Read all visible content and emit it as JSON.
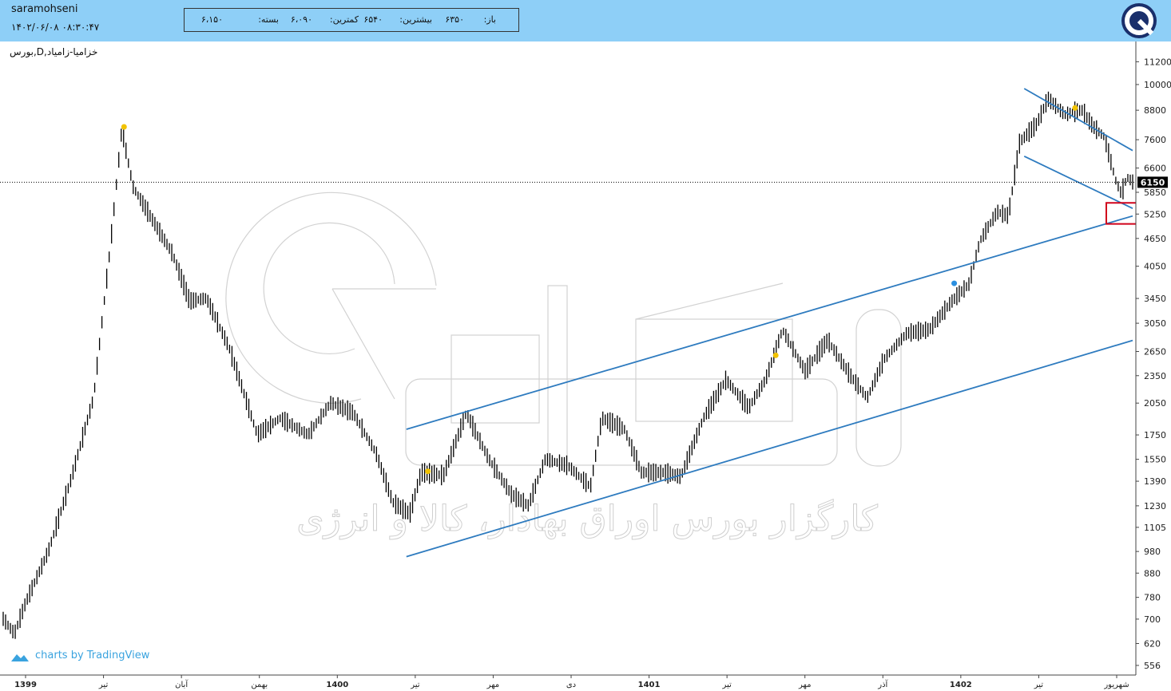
{
  "header": {
    "username": "saramohseni",
    "datetime": "۱۴۰۲/۰۶/۰۸ ۰۸:۳۰:۴۷",
    "ohlc": [
      {
        "label": "باز:",
        "value": "۶۳۵۰"
      },
      {
        "label": "بیشترین:",
        "value": "۶۵۴۰"
      },
      {
        "label": "کمترین:",
        "value": "۶،۰۹۰"
      },
      {
        "label": "بسته:",
        "value": "۶،۱۵۰"
      }
    ]
  },
  "symbol_label": "بورس,D,خزامیا-زامیاد",
  "attribution": "charts by TradingView",
  "watermark_text": "کارگزار بورس اوراق بهادار، کالا و انرژی",
  "colors": {
    "header_bg": "#8ecff7",
    "trendline": "#2e7bbf",
    "box": "#d0021b",
    "marker_yellow": "#f2c300",
    "marker_blue": "#2a8fe0",
    "price_tag_bg": "#000000"
  },
  "icons": [
    "brand-logo-icon",
    "tradingview-icon"
  ],
  "chart_data": {
    "type": "bar",
    "scale": "log",
    "ylim": [
      530,
      12000
    ],
    "y_ticks": [
      556,
      620,
      700,
      780,
      880,
      980,
      1105,
      1230,
      1390,
      1550,
      1750,
      2050,
      2350,
      2650,
      3050,
      3450,
      4050,
      4650,
      5250,
      5850,
      6600,
      7600,
      8800,
      10000,
      11200
    ],
    "x_ticks": [
      "1399",
      "تیر",
      "آبان",
      "بهمن",
      "1400",
      "تیر",
      "مهر",
      "دی",
      "1401",
      "تیر",
      "مهر",
      "آذر",
      "1402",
      "تیر",
      "شهریور"
    ],
    "last_price": {
      "value": 6150,
      "label": "6150"
    },
    "price_path": [
      {
        "t": 0.0,
        "p": 700
      },
      {
        "t": 0.01,
        "p": 650
      },
      {
        "t": 0.02,
        "p": 760
      },
      {
        "t": 0.04,
        "p": 980
      },
      {
        "t": 0.06,
        "p": 1400
      },
      {
        "t": 0.08,
        "p": 2100
      },
      {
        "t": 0.095,
        "p": 4500
      },
      {
        "t": 0.105,
        "p": 8000
      },
      {
        "t": 0.115,
        "p": 6000
      },
      {
        "t": 0.13,
        "p": 5200
      },
      {
        "t": 0.15,
        "p": 4300
      },
      {
        "t": 0.165,
        "p": 3400
      },
      {
        "t": 0.18,
        "p": 3450
      },
      {
        "t": 0.2,
        "p": 2700
      },
      {
        "t": 0.225,
        "p": 1750
      },
      {
        "t": 0.245,
        "p": 1900
      },
      {
        "t": 0.27,
        "p": 1750
      },
      {
        "t": 0.29,
        "p": 2050
      },
      {
        "t": 0.31,
        "p": 1950
      },
      {
        "t": 0.33,
        "p": 1600
      },
      {
        "t": 0.345,
        "p": 1250
      },
      {
        "t": 0.36,
        "p": 1180
      },
      {
        "t": 0.37,
        "p": 1450
      },
      {
        "t": 0.39,
        "p": 1430
      },
      {
        "t": 0.41,
        "p": 1950
      },
      {
        "t": 0.43,
        "p": 1550
      },
      {
        "t": 0.45,
        "p": 1300
      },
      {
        "t": 0.465,
        "p": 1230
      },
      {
        "t": 0.48,
        "p": 1550
      },
      {
        "t": 0.5,
        "p": 1500
      },
      {
        "t": 0.52,
        "p": 1350
      },
      {
        "t": 0.53,
        "p": 1900
      },
      {
        "t": 0.55,
        "p": 1800
      },
      {
        "t": 0.565,
        "p": 1450
      },
      {
        "t": 0.585,
        "p": 1450
      },
      {
        "t": 0.6,
        "p": 1420
      },
      {
        "t": 0.62,
        "p": 1900
      },
      {
        "t": 0.64,
        "p": 2300
      },
      {
        "t": 0.66,
        "p": 2000
      },
      {
        "t": 0.675,
        "p": 2300
      },
      {
        "t": 0.69,
        "p": 2950
      },
      {
        "t": 0.71,
        "p": 2400
      },
      {
        "t": 0.73,
        "p": 2800
      },
      {
        "t": 0.75,
        "p": 2350
      },
      {
        "t": 0.765,
        "p": 2100
      },
      {
        "t": 0.78,
        "p": 2550
      },
      {
        "t": 0.8,
        "p": 2900
      },
      {
        "t": 0.82,
        "p": 2950
      },
      {
        "t": 0.84,
        "p": 3400
      },
      {
        "t": 0.855,
        "p": 3700
      },
      {
        "t": 0.865,
        "p": 4600
      },
      {
        "t": 0.88,
        "p": 5300
      },
      {
        "t": 0.89,
        "p": 5200
      },
      {
        "t": 0.9,
        "p": 7500
      },
      {
        "t": 0.915,
        "p": 8200
      },
      {
        "t": 0.925,
        "p": 9300
      },
      {
        "t": 0.94,
        "p": 8600
      },
      {
        "t": 0.955,
        "p": 8800
      },
      {
        "t": 0.965,
        "p": 8100
      },
      {
        "t": 0.975,
        "p": 7700
      },
      {
        "t": 0.985,
        "p": 6200
      },
      {
        "t": 0.99,
        "p": 5800
      },
      {
        "t": 0.995,
        "p": 6300
      },
      {
        "t": 1.0,
        "p": 6150
      }
    ],
    "trendlines": [
      {
        "x1": 0.357,
        "p1": 1800,
        "x2": 1.0,
        "p2": 5200
      },
      {
        "x1": 0.357,
        "p1": 955,
        "x2": 1.0,
        "p2": 2800
      },
      {
        "x1": 0.904,
        "p1": 9800,
        "x2": 1.0,
        "p2": 7200
      },
      {
        "x1": 0.904,
        "p1": 7000,
        "x2": 1.0,
        "p2": 5400
      }
    ],
    "markers": [
      {
        "t": 0.107,
        "p": 8100,
        "color": "yellow"
      },
      {
        "t": 0.376,
        "p": 1460,
        "color": "yellow"
      },
      {
        "t": 0.684,
        "p": 2600,
        "color": "yellow"
      },
      {
        "t": 0.842,
        "p": 3720,
        "color": "blue"
      },
      {
        "t": 0.949,
        "p": 8900,
        "color": "yellow"
      }
    ],
    "highlight_zone": {
      "p_top": 5550,
      "p_bottom": 5000
    }
  }
}
